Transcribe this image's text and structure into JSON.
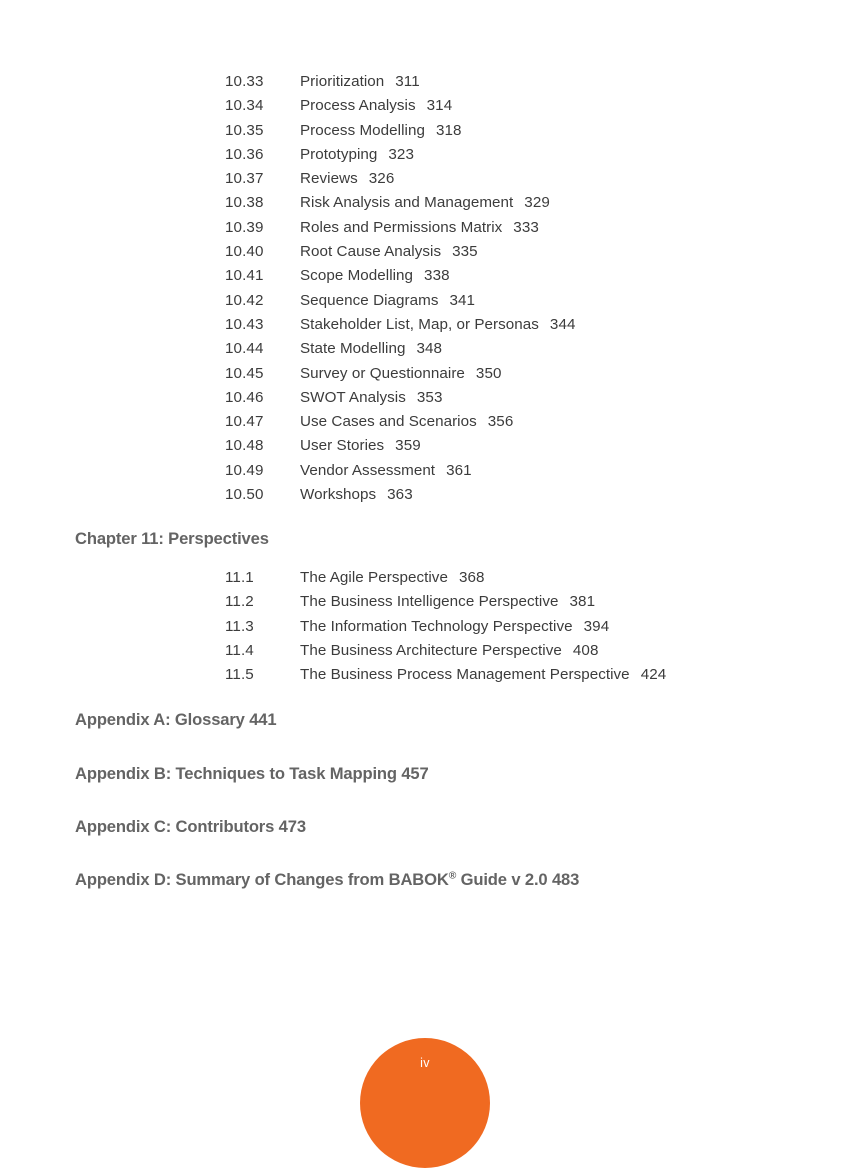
{
  "page": {
    "folio_label": "iv",
    "folio_color": "#F06A21",
    "heading_color": "#646464",
    "body_color": "#3c3c3c"
  },
  "toc": {
    "techniques_entries": [
      {
        "number": "10.33",
        "title": "Prioritization",
        "page": "311"
      },
      {
        "number": "10.34",
        "title": "Process Analysis",
        "page": "314"
      },
      {
        "number": "10.35",
        "title": "Process Modelling",
        "page": "318"
      },
      {
        "number": "10.36",
        "title": "Prototyping",
        "page": "323"
      },
      {
        "number": "10.37",
        "title": "Reviews",
        "page": "326"
      },
      {
        "number": "10.38",
        "title": "Risk Analysis and Management",
        "page": "329"
      },
      {
        "number": "10.39",
        "title": "Roles and Permissions Matrix",
        "page": "333"
      },
      {
        "number": "10.40",
        "title": "Root Cause Analysis",
        "page": "335"
      },
      {
        "number": "10.41",
        "title": "Scope Modelling",
        "page": "338"
      },
      {
        "number": "10.42",
        "title": "Sequence Diagrams",
        "page": "341"
      },
      {
        "number": "10.43",
        "title": "Stakeholder List, Map, or Personas",
        "page": "344"
      },
      {
        "number": "10.44",
        "title": "State Modelling",
        "page": "348"
      },
      {
        "number": "10.45",
        "title": "Survey or Questionnaire",
        "page": "350"
      },
      {
        "number": "10.46",
        "title": "SWOT Analysis",
        "page": "353"
      },
      {
        "number": "10.47",
        "title": "Use Cases and Scenarios",
        "page": "356"
      },
      {
        "number": "10.48",
        "title": "User Stories",
        "page": "359"
      },
      {
        "number": "10.49",
        "title": "Vendor Assessment",
        "page": "361"
      },
      {
        "number": "10.50",
        "title": "Workshops",
        "page": "363"
      }
    ],
    "chapter11": {
      "heading": "Chapter 11: Perspectives",
      "entries": [
        {
          "number": "11.1",
          "title": "The Agile Perspective",
          "page": "368"
        },
        {
          "number": "11.2",
          "title": "The Business Intelligence Perspective",
          "page": "381"
        },
        {
          "number": "11.3",
          "title": "The Information Technology Perspective",
          "page": "394"
        },
        {
          "number": "11.4",
          "title": "The Business Architecture Perspective",
          "page": "408"
        },
        {
          "number": "11.5",
          "title": "The Business Process Management Perspective",
          "page": "424"
        }
      ]
    },
    "appendices": [
      {
        "text": "Appendix A: Glossary 441"
      },
      {
        "text": "Appendix B: Techniques to Task Mapping 457"
      },
      {
        "text": "Appendix C: Contributors 473"
      },
      {
        "text_before": "Appendix D: Summary of Changes from BABOK",
        "superscript": "®",
        "text_after": " Guide v 2.0 483"
      }
    ]
  }
}
